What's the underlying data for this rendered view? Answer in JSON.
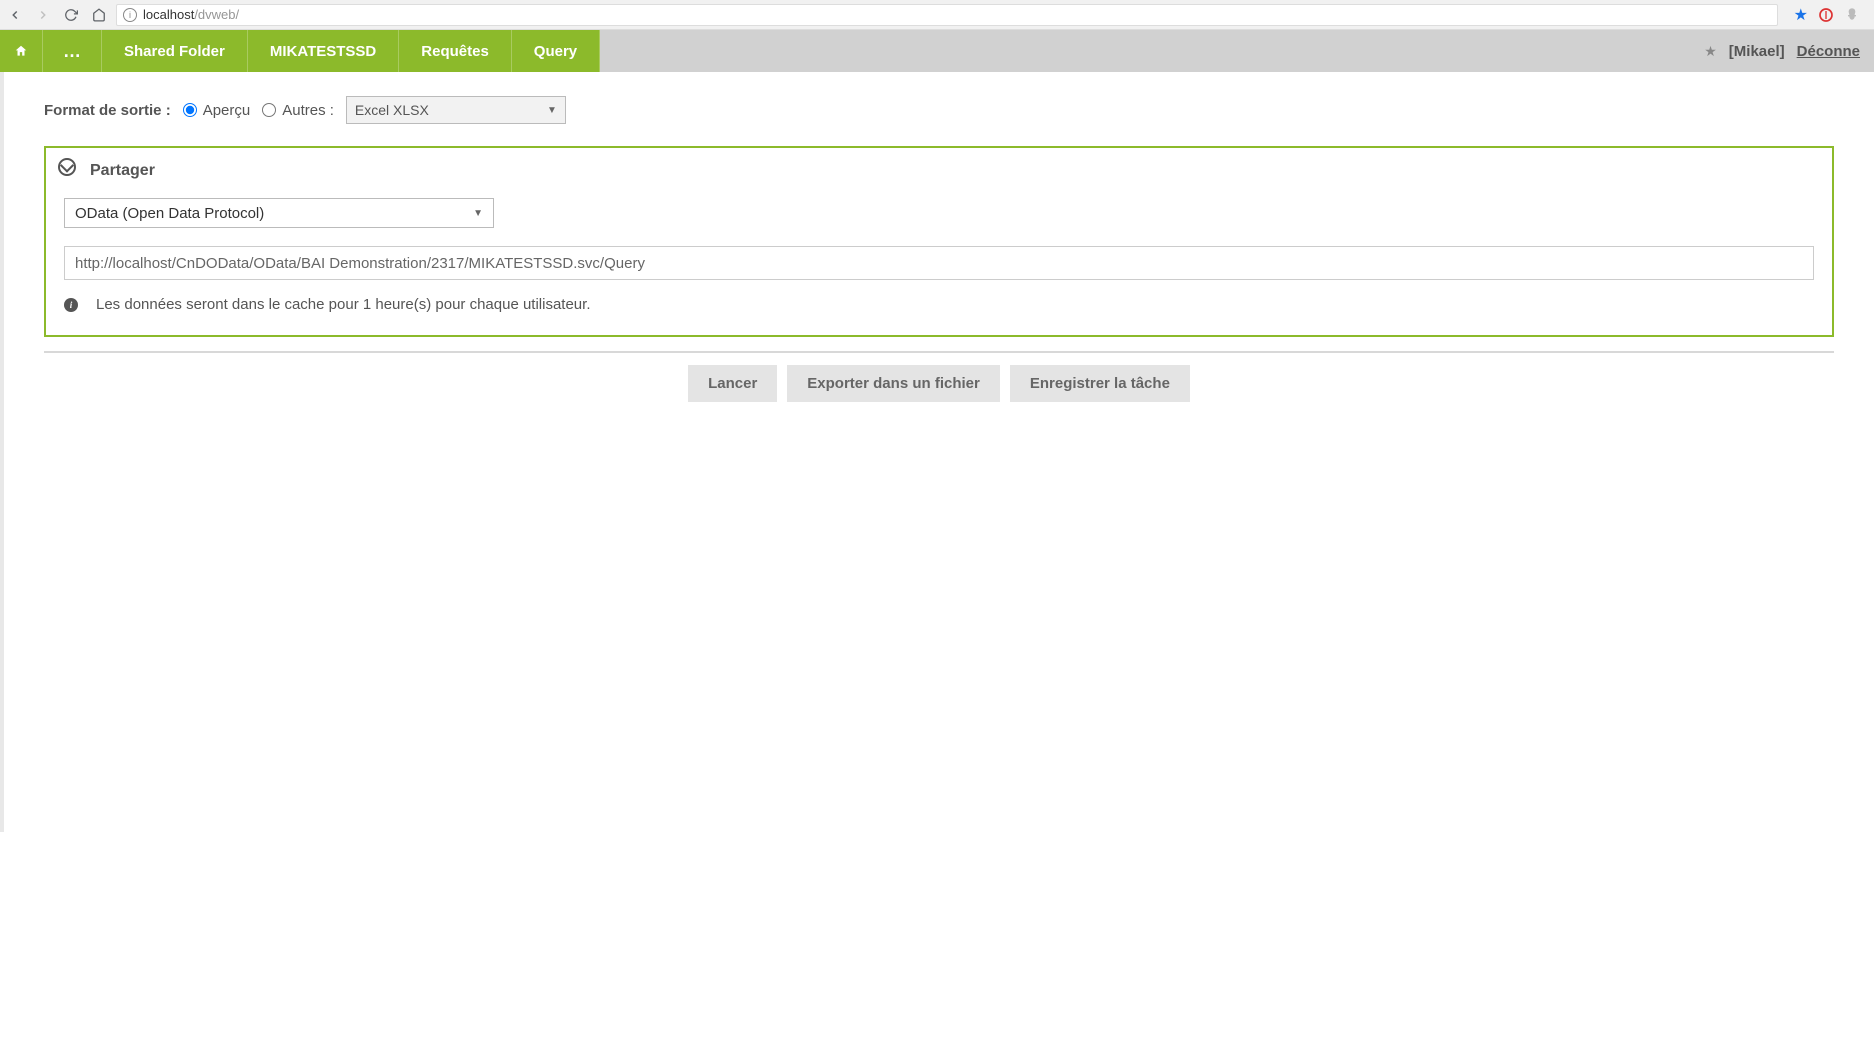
{
  "browser": {
    "url_host": "localhost",
    "url_path": "/dvweb/"
  },
  "nav": {
    "tabs": [
      "Shared Folder",
      "MIKATESTSSD",
      "Requêtes",
      "Query"
    ],
    "user": "Mikael",
    "logout": "Déconne"
  },
  "format": {
    "label": "Format de sortie :",
    "apercu": "Aperçu",
    "autres": "Autres :",
    "format_select": "Excel XLSX"
  },
  "share": {
    "title": "Partager",
    "protocol": "OData (Open Data Protocol)",
    "url": "http://localhost/CnDOData/OData/BAI Demonstration/2317/MIKATESTSSD.svc/Query",
    "info": "Les données seront dans le cache pour 1 heure(s) pour chaque utilisateur."
  },
  "actions": {
    "lancer": "Lancer",
    "exporter": "Exporter dans un fichier",
    "enregistrer": "Enregistrer la tâche"
  }
}
